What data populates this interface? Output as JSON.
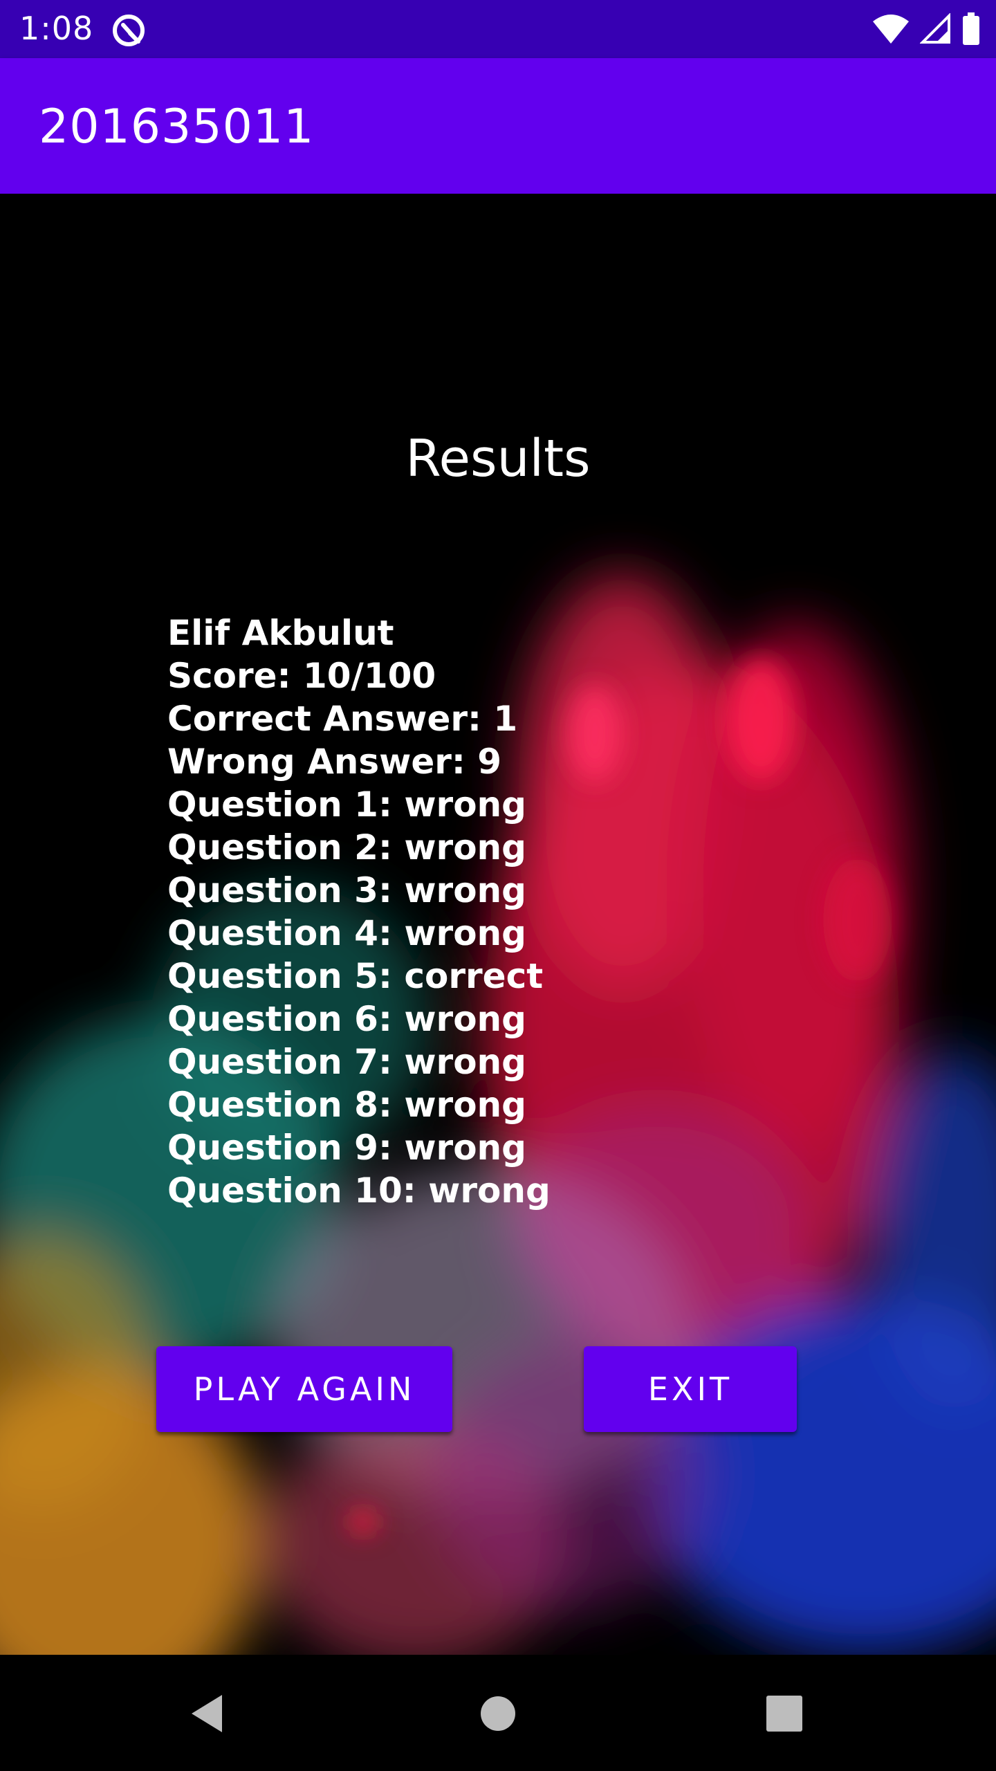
{
  "status_bar": {
    "time": "1:08",
    "icons": [
      "app-notification-icon",
      "wifi-icon",
      "cell-signal-icon",
      "battery-icon"
    ]
  },
  "app_bar": {
    "title": "201635011"
  },
  "results": {
    "title": "Results",
    "lines": [
      "Elif Akbulut",
      "Score: 10/100",
      "Correct Answer: 1",
      "Wrong Answer: 9",
      "Question 1: wrong",
      "Question 2: wrong",
      "Question 3: wrong",
      "Question 4: wrong",
      "Question 5: correct",
      "Question 6: wrong",
      "Question 7: wrong",
      "Question 8: wrong",
      "Question 9: wrong",
      "Question 10: wrong"
    ]
  },
  "buttons": {
    "play_again": "PLAY AGAIN",
    "exit": "EXIT"
  },
  "nav_bar": {
    "icons": [
      "back-icon",
      "home-icon",
      "recents-icon"
    ]
  },
  "colors": {
    "status_bar": "#3700b3",
    "app_bar": "#6200ee",
    "button": "#6200ee",
    "background": "#000000"
  }
}
